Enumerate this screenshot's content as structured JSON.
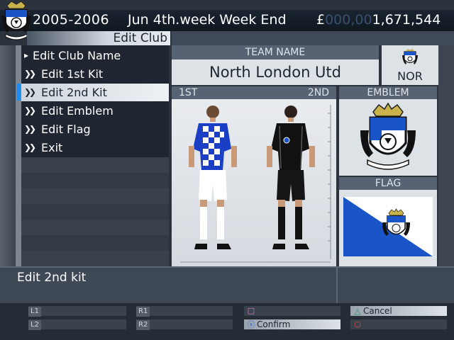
{
  "header": {
    "season": "2005-2006",
    "date": "Jun 4th.week Week End",
    "currency": "£",
    "money_padding": "000,00",
    "money": "1,671,544"
  },
  "screen_title": "Edit Club",
  "menu": {
    "items": [
      {
        "label": "Edit Club Name",
        "icon": "arrow-right-icon"
      },
      {
        "label": "Edit 1st Kit",
        "icon": "double-chevron-icon"
      },
      {
        "label": "Edit 2nd Kit",
        "icon": "double-chevron-icon"
      },
      {
        "label": "Edit Emblem",
        "icon": "double-chevron-icon"
      },
      {
        "label": "Edit Flag",
        "icon": "double-chevron-icon"
      },
      {
        "label": "Exit",
        "icon": "double-chevron-icon"
      }
    ],
    "selected_index": 2
  },
  "team": {
    "header": "TEAM NAME",
    "name": "North London Utd",
    "short": "NOR"
  },
  "kits": {
    "label_first": "1ST",
    "label_second": "2ND"
  },
  "emblem": {
    "header": "EMBLEM"
  },
  "flag": {
    "header": "FLAG",
    "color_primary": "#1a55c8",
    "color_secondary": "#ffffff"
  },
  "description": "Edit 2nd kit",
  "buttons": {
    "l1": "L1",
    "l2": "L2",
    "r1": "R1",
    "r2": "R2",
    "cancel": "Cancel",
    "confirm": "Confirm"
  },
  "colors": {
    "accent": "#1f8be8",
    "kit1_primary": "#1a3fc4",
    "kit1_secondary": "#ffffff",
    "kit2_primary": "#111111"
  }
}
